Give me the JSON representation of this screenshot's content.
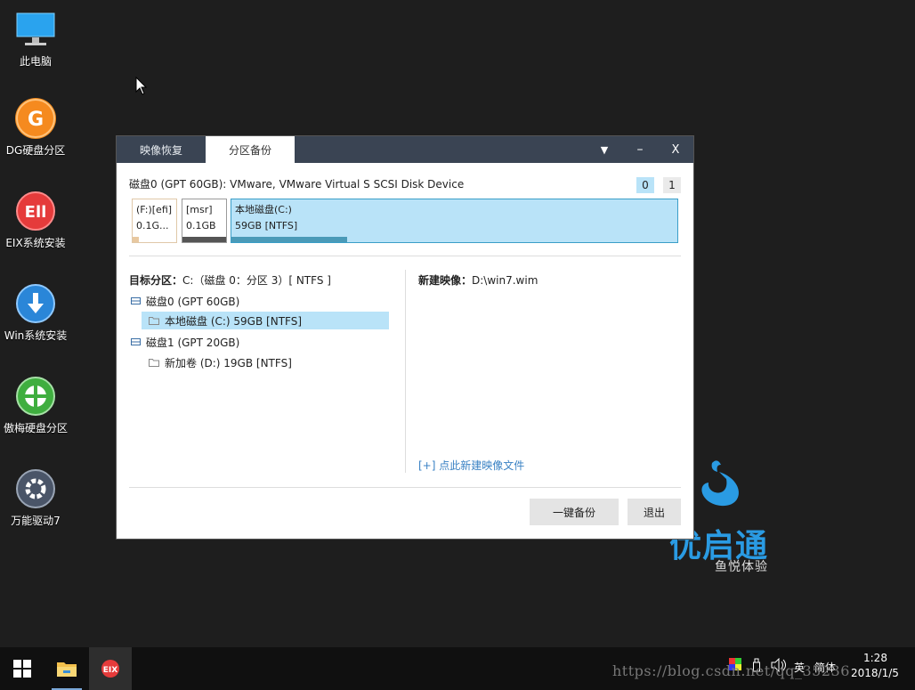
{
  "desktop": {
    "icons": [
      {
        "label": "此电脑",
        "icon": "computer-icon"
      },
      {
        "label": "DG硬盘分区",
        "icon": "dg-partition-icon"
      },
      {
        "label": "EIX系统安装",
        "icon": "eix-install-icon"
      },
      {
        "label": "Win系统安装",
        "icon": "win-install-icon"
      },
      {
        "label": "傲梅硬盘分区",
        "icon": "aomei-partition-icon"
      },
      {
        "label": "万能驱动7",
        "icon": "driver-gear-icon"
      }
    ],
    "brand": {
      "name": "优启通",
      "sub": "鱼悦体验"
    }
  },
  "dialog": {
    "tabs": [
      "映像恢复",
      "分区备份"
    ],
    "active_tab": 1,
    "title_controls": {
      "menu": "▼",
      "minimize": "–",
      "close": "X"
    },
    "disk_header": "磁盘0 (GPT 60GB): VMware, VMware Virtual S SCSI Disk Device",
    "disk_switch": [
      "0",
      "1"
    ],
    "partitions": [
      {
        "line1": "(F:)[efi]",
        "line2": "0.1G...",
        "fill": 0.15
      },
      {
        "line1": "[msr]",
        "line2": "0.1GB",
        "fill": 1.0
      },
      {
        "line1": "本地磁盘(C:)",
        "line2": "59GB [NTFS]",
        "fill": 0.26
      }
    ],
    "target": {
      "label": "目标分区：",
      "value": "C:（磁盘 0：分区 3）[ NTFS ]"
    },
    "tree": [
      {
        "label": "磁盘0 (GPT 60GB)",
        "level": 0,
        "icon": "disk-icon"
      },
      {
        "label": "本地磁盘 (C:) 59GB [NTFS]",
        "level": 1,
        "icon": "folder-icon",
        "selected": true
      },
      {
        "label": "磁盘1 (GPT 20GB)",
        "level": 0,
        "icon": "disk-icon"
      },
      {
        "label": "新加卷 (D:) 19GB [NTFS]",
        "level": 1,
        "icon": "folder-icon"
      }
    ],
    "new_image": {
      "label": "新建映像：",
      "value": "D:\\win7.wim"
    },
    "new_image_link": "[+] 点此新建映像文件",
    "buttons": {
      "backup": "一键备份",
      "exit": "退出"
    }
  },
  "taskbar": {
    "ime": "英",
    "ime_mode": "简体",
    "time": "1:28",
    "date": "2018/1/5"
  },
  "watermark": "https://blog.csdn.net/qq_35236"
}
